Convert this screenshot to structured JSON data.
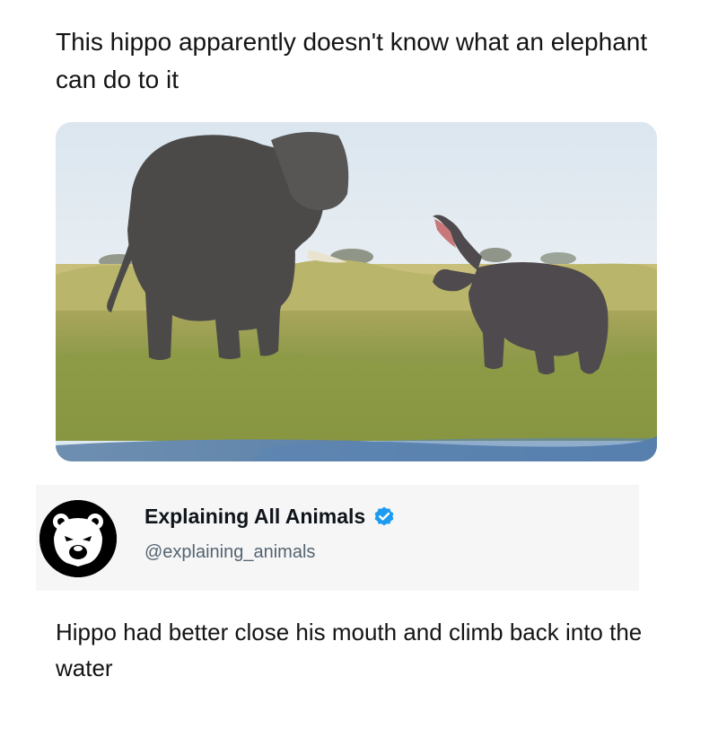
{
  "post": {
    "headline": "This hippo apparently doesn't know what an elephant can do to it",
    "tweet_text": "Hippo had better close his mouth and climb back into the water"
  },
  "author": {
    "display_name": "Explaining All Animals",
    "handle": "@explaining_animals",
    "verified": true,
    "avatar_icon": "bear-face-icon",
    "verified_icon": "verified-badge-icon"
  },
  "colors": {
    "verified_badge": "#1d9bf0",
    "handle": "#536471",
    "avatar_bg": "#000000"
  }
}
